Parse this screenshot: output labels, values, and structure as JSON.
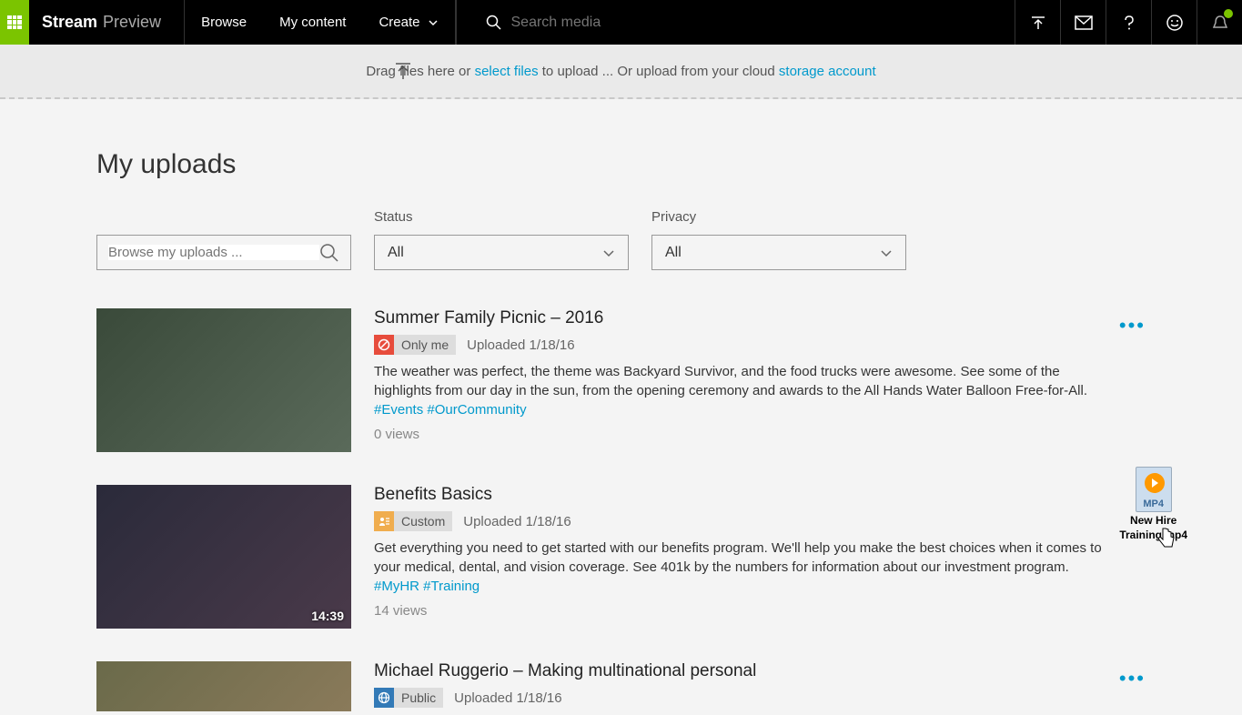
{
  "brand": {
    "main": "Stream",
    "sub": "Preview"
  },
  "nav": {
    "browse": "Browse",
    "mycontent": "My content",
    "create": "Create"
  },
  "search": {
    "placeholder": "Search media"
  },
  "uploadBar": {
    "text1": "Drag files here or ",
    "link1": "select files",
    "text2": " to upload ...   Or upload from your cloud ",
    "link2": "storage account"
  },
  "pageTitle": "My uploads",
  "filters": {
    "searchPlaceholder": "Browse my uploads ...",
    "statusLabel": "Status",
    "statusValue": "All",
    "privacyLabel": "Privacy",
    "privacyValue": "All"
  },
  "videos": [
    {
      "title": "Summer Family Picnic – 2016",
      "privacy": "Only me",
      "uploaded": "Uploaded 1/18/16",
      "desc": "The weather was perfect, the theme was Backyard Survivor, and the food trucks were awesome. See some of the highlights from our day in the sun, from the opening ceremony and awards to the All Hands Water Balloon Free-for-All. ",
      "tags": "#Events #OurCommunity",
      "views": "0 views",
      "duration": ""
    },
    {
      "title": "Benefits Basics",
      "privacy": "Custom",
      "uploaded": "Uploaded 1/18/16",
      "desc": "Get everything you need to get started with our benefits program. We'll help you make the best choices when it comes to your medical, dental, and vision coverage. See 401k by the numbers for information about our investment program. ",
      "tags": "#MyHR #Training",
      "views": "14 views",
      "duration": "14:39"
    },
    {
      "title": "Michael Ruggerio – Making multinational personal",
      "privacy": "Public",
      "uploaded": "Uploaded 1/18/16",
      "desc": "",
      "tags": "",
      "views": "",
      "duration": ""
    }
  ],
  "dragFile": {
    "ext": "MP4",
    "name1": "New Hire",
    "name2": "Training.mp4"
  }
}
